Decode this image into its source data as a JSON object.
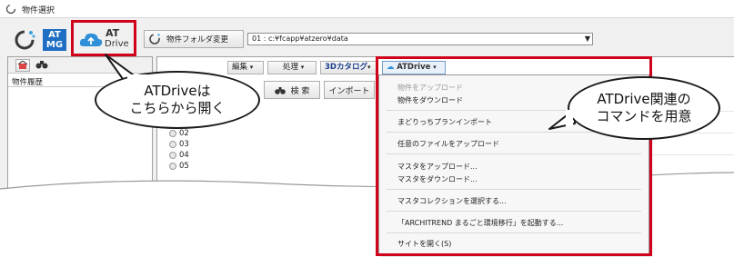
{
  "window": {
    "title": "物件選択"
  },
  "toolbar": {
    "atmg_line1": "AT",
    "atmg_line2": "MG",
    "atdrive_line1": "AT",
    "atdrive_line2": "Drive",
    "folder_change_label": "物件フォルダ変更",
    "folder_path": "01 : c:¥fcapp¥atzero¥data"
  },
  "left_panel": {
    "history_label": "物件履歴"
  },
  "menubar": {
    "edit": "編集",
    "process": "処理",
    "catalog": "3Dカタログ",
    "atdrive": "ATDrive"
  },
  "second_row": {
    "search": "検 索",
    "import": "インポート"
  },
  "list": {
    "items": [
      "02",
      "03",
      "04",
      "05"
    ]
  },
  "dropdown": {
    "items": [
      "物件をアップロード",
      "物件をダウンロード",
      "まどりっちプランインポート",
      "任意のファイルをアップロード",
      "マスタをアップロード...",
      "マスタをダウンロード...",
      "マスタコレクションを選択する...",
      "「ARCHITREND まるごと環境移行」を起動する...",
      "サイトを開く(S)"
    ]
  },
  "callouts": {
    "left_line1": "ATDriveは",
    "left_line2": "こちらから開く",
    "right_line1": "ATDrive関連の",
    "right_line2": "コマンドを用意"
  },
  "colors": {
    "highlight": "#d0021b",
    "atmg_blue": "#1e6fc3",
    "atdrive_blue": "#2f8fd8"
  }
}
